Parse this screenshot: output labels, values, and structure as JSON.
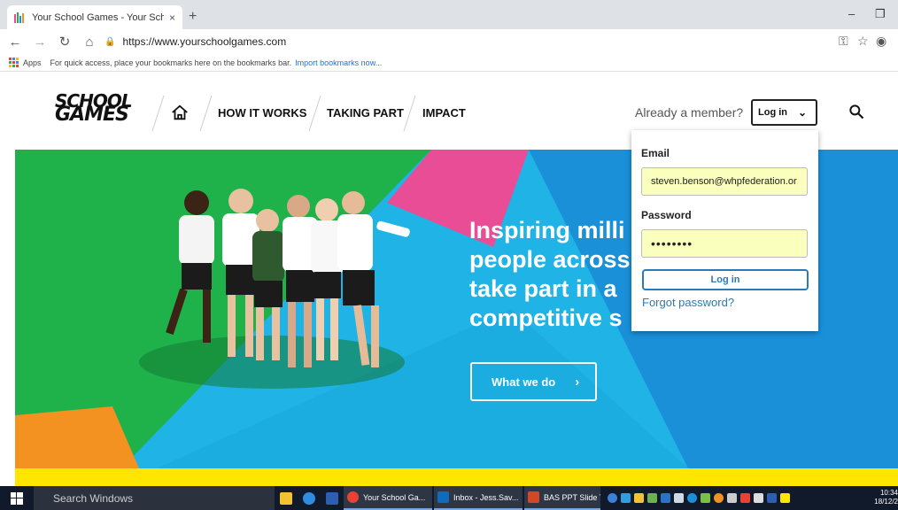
{
  "browser": {
    "tab_title": "Your School Games - Your Schoo",
    "tab_close": "×",
    "new_tab": "+",
    "minimize": "–",
    "restore": "❐",
    "url": "https://www.yourschoolgames.com",
    "bookmarks_apps": "Apps",
    "bookmarks_hint": "For quick access, place your bookmarks here on the bookmarks bar.",
    "bookmarks_import": "Import bookmarks now..."
  },
  "site": {
    "logo_line1": "SCHOOL",
    "logo_line2": "GAMES",
    "nav": [
      "HOW IT WORKS",
      "TAKING PART",
      "IMPACT"
    ],
    "member_text": "Already a member?",
    "login_toggle": "Log in"
  },
  "hero": {
    "lines": [
      "Inspiring milli",
      "people across",
      "take part in a",
      "competitive s"
    ],
    "cta": "What we do",
    "cta_arrow": "›",
    "colors": {
      "green": "#1fb24a",
      "pink": "#e84d96",
      "cyan": "#1fb3e6",
      "blue": "#1a90d9",
      "orange": "#f39220",
      "yellow": "#ffe600"
    }
  },
  "login_panel": {
    "email_label": "Email",
    "email_value": "steven.benson@whpfederation.or",
    "password_label": "Password",
    "password_value": "••••••••",
    "submit": "Log in",
    "forgot": "Forgot password?"
  },
  "taskbar": {
    "search_placeholder": "Search Windows",
    "apps": [
      "Your School Ga...",
      "Inbox - Jess.Sav...",
      "BAS PPT Slide T..."
    ],
    "time": "10:34",
    "date": "18/12/2"
  }
}
